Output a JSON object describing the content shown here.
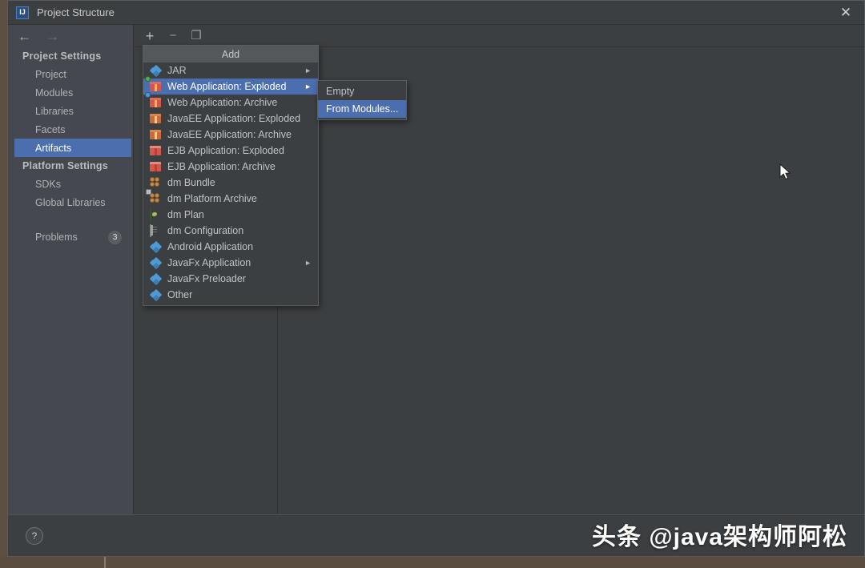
{
  "window": {
    "title": "Project Structure",
    "app_icon": "IJ",
    "close_label": "✕"
  },
  "nav": {
    "back_icon": "←",
    "forward_icon": "→"
  },
  "sidebar": {
    "groups": [
      {
        "label": "Project Settings",
        "items": [
          {
            "label": "Project",
            "selected": false
          },
          {
            "label": "Modules",
            "selected": false
          },
          {
            "label": "Libraries",
            "selected": false
          },
          {
            "label": "Facets",
            "selected": false
          },
          {
            "label": "Artifacts",
            "selected": true
          }
        ]
      },
      {
        "label": "Platform Settings",
        "items": [
          {
            "label": "SDKs",
            "selected": false
          },
          {
            "label": "Global Libraries",
            "selected": false
          }
        ]
      }
    ],
    "problems": {
      "label": "Problems",
      "count": "3"
    }
  },
  "toolbar": {
    "add_icon": "+",
    "remove_icon": "−",
    "copy_icon": "❐"
  },
  "add_menu": {
    "header": "Add",
    "items": [
      {
        "label": "JAR",
        "icon": "jar-icon",
        "kind": "diamond",
        "submenu": true,
        "selected": false
      },
      {
        "label": "Web Application: Exploded",
        "icon": "web-app-exploded-icon",
        "kind": "gift-web",
        "submenu": true,
        "selected": true
      },
      {
        "label": "Web Application: Archive",
        "icon": "web-app-archive-icon",
        "kind": "gift-web-blue",
        "submenu": false,
        "selected": false
      },
      {
        "label": "JavaEE Application: Exploded",
        "icon": "javaee-exploded-icon",
        "kind": "gift-ee",
        "submenu": false,
        "selected": false
      },
      {
        "label": "JavaEE Application: Archive",
        "icon": "javaee-archive-icon",
        "kind": "gift-ee",
        "submenu": false,
        "selected": false
      },
      {
        "label": "EJB Application: Exploded",
        "icon": "ejb-exploded-icon",
        "kind": "gift-ejb",
        "submenu": false,
        "selected": false
      },
      {
        "label": "EJB Application: Archive",
        "icon": "ejb-archive-icon",
        "kind": "gift-ejb",
        "submenu": false,
        "selected": false
      },
      {
        "label": "dm Bundle",
        "icon": "dm-bundle-icon",
        "kind": "bundle",
        "submenu": false,
        "selected": false
      },
      {
        "label": "dm Platform Archive",
        "icon": "dm-platform-archive-icon",
        "kind": "bundle-lock",
        "submenu": false,
        "selected": false
      },
      {
        "label": "dm Plan",
        "icon": "dm-plan-icon",
        "kind": "globe",
        "submenu": false,
        "selected": false
      },
      {
        "label": "dm Configuration",
        "icon": "dm-configuration-icon",
        "kind": "doc",
        "submenu": false,
        "selected": false
      },
      {
        "label": "Android Application",
        "icon": "android-application-icon",
        "kind": "diamond",
        "submenu": false,
        "selected": false
      },
      {
        "label": "JavaFx Application",
        "icon": "javafx-application-icon",
        "kind": "diamond",
        "submenu": true,
        "selected": false
      },
      {
        "label": "JavaFx Preloader",
        "icon": "javafx-preloader-icon",
        "kind": "diamond",
        "submenu": false,
        "selected": false
      },
      {
        "label": "Other",
        "icon": "other-icon",
        "kind": "diamond",
        "submenu": false,
        "selected": false
      }
    ],
    "submenu_arrow": "►"
  },
  "submenu": {
    "items": [
      {
        "label": "Empty",
        "selected": false
      },
      {
        "label": "From Modules...",
        "selected": true
      }
    ]
  },
  "bottom": {
    "help_icon": "?"
  },
  "watermark": {
    "text": "头条 @java架构师阿松"
  },
  "colors": {
    "window_bg": "#3c3f41",
    "sidebar_bg": "#45484f",
    "selection_blue": "#4b6eaf",
    "menu_header_bg": "#55585a",
    "text_primary": "#bfc2c6",
    "desktop_bg": "#6b5a4b"
  }
}
